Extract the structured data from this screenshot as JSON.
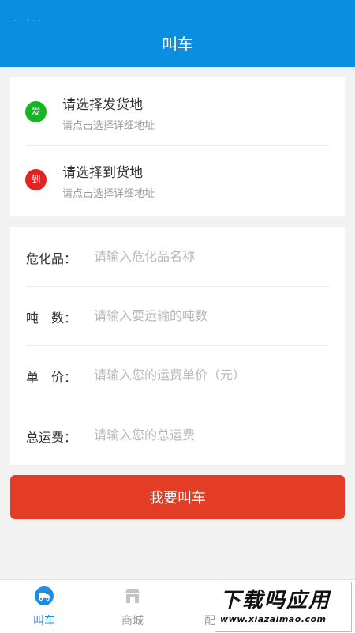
{
  "header": {
    "title": "叫车",
    "status_dots": "· · · · · ·"
  },
  "addresses": [
    {
      "badge": "发",
      "title": "请选择发货地",
      "hint": "请点击选择详细地址",
      "color": "#19b425"
    },
    {
      "badge": "到",
      "title": "请选择到货地",
      "hint": "请点击选择详细地址",
      "color": "#e52222"
    }
  ],
  "form": {
    "fields": [
      {
        "label": "危化品：",
        "placeholder": "请输入危化品名称",
        "value": ""
      },
      {
        "label": "吨　数：",
        "placeholder": "请输入要运输的吨数",
        "value": ""
      },
      {
        "label": "单　价：",
        "placeholder": "请输入您的运费单价（元）",
        "value": ""
      },
      {
        "label": "总运费：",
        "placeholder": "请输入您的总运费",
        "value": ""
      }
    ]
  },
  "submit_label": "我要叫车",
  "tabbar": {
    "items": [
      {
        "label": "叫车",
        "icon": "truck-icon",
        "active": true
      },
      {
        "label": "商城",
        "icon": "shop-icon",
        "active": false
      },
      {
        "label": "配",
        "icon": "delivery-icon",
        "active": false
      }
    ]
  },
  "watermark": {
    "text": "下载吗应用",
    "url": "www.xiazaimao.com"
  },
  "colors": {
    "primary": "#0a8ee0",
    "accent": "#e43d25",
    "active_tab": "#1a8fe3"
  }
}
